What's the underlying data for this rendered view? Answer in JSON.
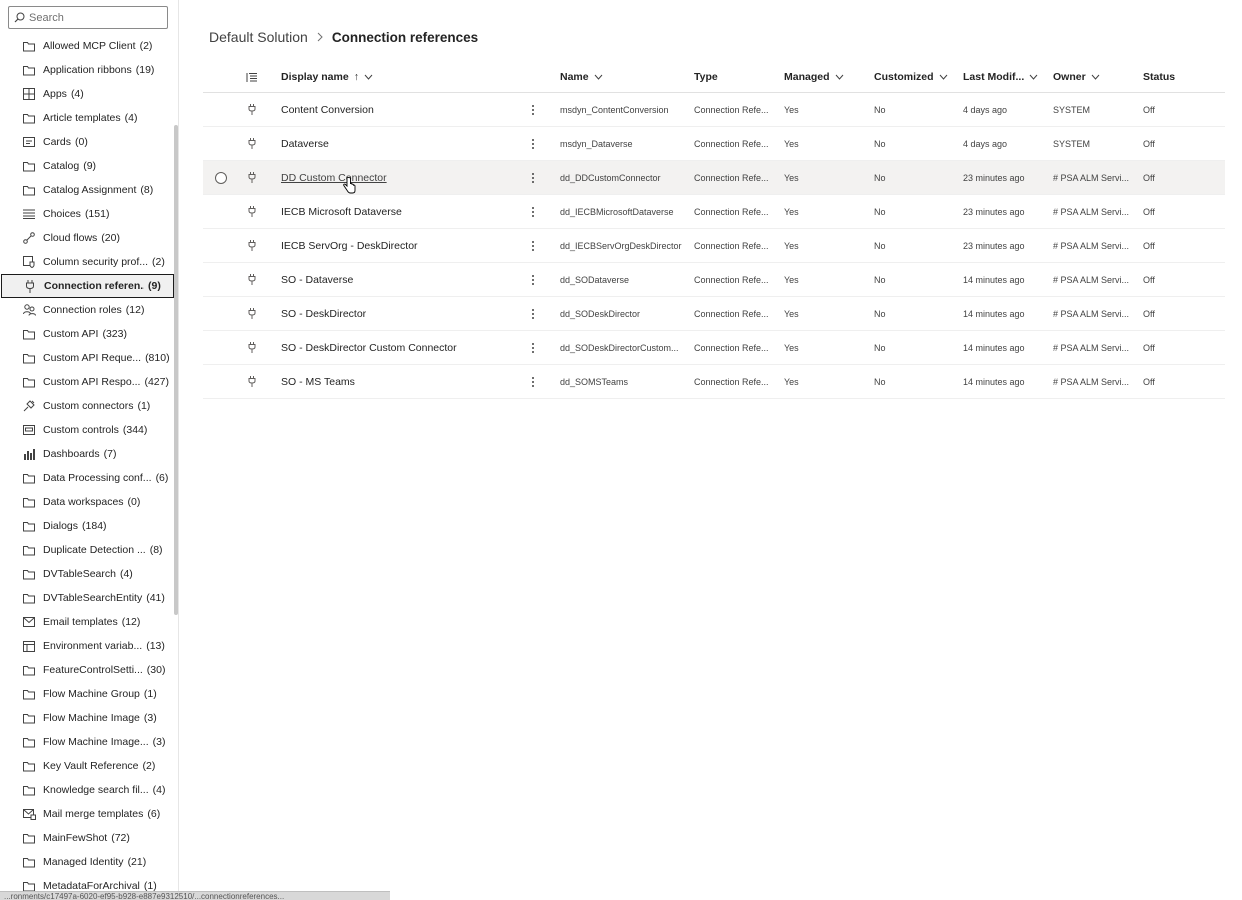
{
  "search": {
    "placeholder": "Search"
  },
  "sidebar": {
    "items": [
      {
        "label": "Allowed MCP Client",
        "count": "(2)",
        "icon": "folder-icon"
      },
      {
        "label": "Application ribbons",
        "count": "(19)",
        "icon": "folder-icon"
      },
      {
        "label": "Apps",
        "count": "(4)",
        "icon": "apps-icon"
      },
      {
        "label": "Article templates",
        "count": "(4)",
        "icon": "folder-icon"
      },
      {
        "label": "Cards",
        "count": "(0)",
        "icon": "card-icon"
      },
      {
        "label": "Catalog",
        "count": "(9)",
        "icon": "folder-icon"
      },
      {
        "label": "Catalog Assignment",
        "count": "(8)",
        "icon": "folder-icon"
      },
      {
        "label": "Choices",
        "count": "(151)",
        "icon": "list-icon"
      },
      {
        "label": "Cloud flows",
        "count": "(20)",
        "icon": "flow-icon"
      },
      {
        "label": "Column security prof...",
        "count": "(2)",
        "icon": "shield-doc-icon"
      },
      {
        "label": "Connection referen...",
        "count": "(9)",
        "icon": "plug-icon",
        "selected": true
      },
      {
        "label": "Connection roles",
        "count": "(12)",
        "icon": "people-icon"
      },
      {
        "label": "Custom API",
        "count": "(323)",
        "icon": "folder-icon"
      },
      {
        "label": "Custom API Reque...",
        "count": "(810)",
        "icon": "folder-icon"
      },
      {
        "label": "Custom API Respo...",
        "count": "(427)",
        "icon": "folder-icon"
      },
      {
        "label": "Custom connectors",
        "count": "(1)",
        "icon": "connector-icon"
      },
      {
        "label": "Custom controls",
        "count": "(344)",
        "icon": "control-icon"
      },
      {
        "label": "Dashboards",
        "count": "(7)",
        "icon": "dashboard-icon"
      },
      {
        "label": "Data Processing conf...",
        "count": "(6)",
        "icon": "folder-icon"
      },
      {
        "label": "Data workspaces",
        "count": "(0)",
        "icon": "folder-icon"
      },
      {
        "label": "Dialogs",
        "count": "(184)",
        "icon": "folder-icon"
      },
      {
        "label": "Duplicate Detection ...",
        "count": "(8)",
        "icon": "folder-icon"
      },
      {
        "label": "DVTableSearch",
        "count": "(4)",
        "icon": "folder-icon"
      },
      {
        "label": "DVTableSearchEntity",
        "count": "(41)",
        "icon": "folder-icon"
      },
      {
        "label": "Email templates",
        "count": "(12)",
        "icon": "mail-icon"
      },
      {
        "label": "Environment variab...",
        "count": "(13)",
        "icon": "table-icon"
      },
      {
        "label": "FeatureControlSetti...",
        "count": "(30)",
        "icon": "folder-icon"
      },
      {
        "label": "Flow Machine Group",
        "count": "(1)",
        "icon": "folder-icon"
      },
      {
        "label": "Flow Machine Image",
        "count": "(3)",
        "icon": "folder-icon"
      },
      {
        "label": "Flow Machine Image...",
        "count": "(3)",
        "icon": "folder-icon"
      },
      {
        "label": "Key Vault Reference",
        "count": "(2)",
        "icon": "folder-icon"
      },
      {
        "label": "Knowledge search fil...",
        "count": "(4)",
        "icon": "folder-icon"
      },
      {
        "label": "Mail merge templates",
        "count": "(6)",
        "icon": "mail-merge-icon"
      },
      {
        "label": "MainFewShot",
        "count": "(72)",
        "icon": "folder-icon"
      },
      {
        "label": "Managed Identity",
        "count": "(21)",
        "icon": "folder-icon"
      },
      {
        "label": "MetadataForArchival",
        "count": "(1)",
        "icon": "folder-icon"
      }
    ]
  },
  "status_url": "...ronments/c17497a-6020-ef95-b928-e887e9312510/...connectionreferences...",
  "breadcrumb": {
    "parent": "Default Solution",
    "current": "Connection references"
  },
  "grid": {
    "headers": {
      "display_name": "Display name",
      "sort_arrow": "↑",
      "name": "Name",
      "type": "Type",
      "managed": "Managed",
      "customized": "Customized",
      "last_modified": "Last Modif...",
      "owner": "Owner",
      "status": "Status"
    },
    "rows": [
      {
        "display": "Content Conversion",
        "name": "msdyn_ContentConversion",
        "type": "Connection Refe...",
        "managed": "Yes",
        "customized": "No",
        "modified": "4 days ago",
        "owner": "SYSTEM",
        "status": "Off"
      },
      {
        "display": "Dataverse",
        "name": "msdyn_Dataverse",
        "type": "Connection Refe...",
        "managed": "Yes",
        "customized": "No",
        "modified": "4 days ago",
        "owner": "SYSTEM",
        "status": "Off"
      },
      {
        "display": "DD Custom Connector",
        "name": "dd_DDCustomConnector",
        "type": "Connection Refe...",
        "managed": "Yes",
        "customized": "No",
        "modified": "23 minutes ago",
        "owner": "# PSA ALM Servi...",
        "status": "Off",
        "hovered": true
      },
      {
        "display": "IECB Microsoft Dataverse",
        "name": "dd_IECBMicrosoftDataverse",
        "type": "Connection Refe...",
        "managed": "Yes",
        "customized": "No",
        "modified": "23 minutes ago",
        "owner": "# PSA ALM Servi...",
        "status": "Off"
      },
      {
        "display": "IECB ServOrg - DeskDirector",
        "name": "dd_IECBServOrgDeskDirector",
        "type": "Connection Refe...",
        "managed": "Yes",
        "customized": "No",
        "modified": "23 minutes ago",
        "owner": "# PSA ALM Servi...",
        "status": "Off"
      },
      {
        "display": "SO - Dataverse",
        "name": "dd_SODataverse",
        "type": "Connection Refe...",
        "managed": "Yes",
        "customized": "No",
        "modified": "14 minutes ago",
        "owner": "# PSA ALM Servi...",
        "status": "Off"
      },
      {
        "display": "SO - DeskDirector",
        "name": "dd_SODeskDirector",
        "type": "Connection Refe...",
        "managed": "Yes",
        "customized": "No",
        "modified": "14 minutes ago",
        "owner": "# PSA ALM Servi...",
        "status": "Off"
      },
      {
        "display": "SO - DeskDirector Custom Connector",
        "name": "dd_SODeskDirectorCustom...",
        "type": "Connection Refe...",
        "managed": "Yes",
        "customized": "No",
        "modified": "14 minutes ago",
        "owner": "# PSA ALM Servi...",
        "status": "Off"
      },
      {
        "display": "SO - MS Teams",
        "name": "dd_SOMSTeams",
        "type": "Connection Refe...",
        "managed": "Yes",
        "customized": "No",
        "modified": "14 minutes ago",
        "owner": "# PSA ALM Servi...",
        "status": "Off"
      }
    ]
  }
}
